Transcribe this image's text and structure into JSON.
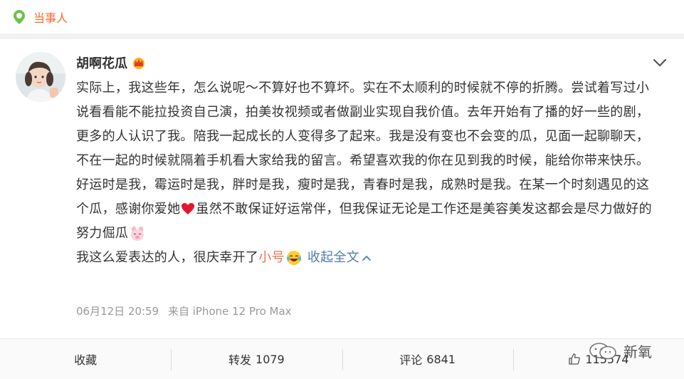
{
  "topbar": {
    "label": "当事人",
    "icon": "location-pin-icon",
    "accent": "#f56a2c"
  },
  "post": {
    "username": "胡啊花瓜",
    "badge_icon": "crown-icon",
    "paragraph1": "实际上，我这些年，怎么说呢～不算好也不算坏。实在不太顺利的时候就不停的折腾。尝试着写过小说看看能不能拉投资自己演，拍美妆视频或者做副业实现自我价值。去年开始有了播的好一些的剧，更多的人认识了我。陪我一起成长的人变得多了起来。我是没有变也不会变的瓜，见面一起聊聊天，不在一起的时候就隔着手机看大家给我的留言。希望喜欢我的你在见到我的时候，能给你带来快乐。",
    "paragraph2_a": "好运时是我，霉运时是我，胖时是我，瘦时是我，青春时是我，成熟时是我。在某一个时刻遇见的这个瓜，感谢你爱她",
    "paragraph2_b": "虽然不敢保证好运常伴，但我保证无论是工作还是美容美发这都会是尽力做好的努力倔瓜",
    "paragraph3_prefix": "我这么爱表达的人，很庆幸开了",
    "paragraph3_link": "小号",
    "collapse_label": "收起全文",
    "date": "06月12日 20:59",
    "source": "来自 iPhone 12 Pro Max"
  },
  "actions": {
    "favorite": {
      "label": "收藏"
    },
    "repost": {
      "label": "转发",
      "count": "1079"
    },
    "comment": {
      "label": "评论",
      "count": "6841"
    },
    "like": {
      "count": "115574"
    }
  },
  "watermark": {
    "text": "新氧"
  },
  "colors": {
    "link_blue": "#507daf",
    "link_red": "#eb7350"
  }
}
